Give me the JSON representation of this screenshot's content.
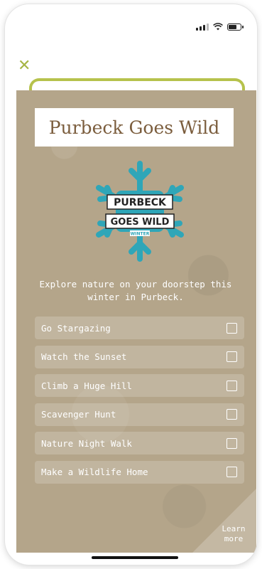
{
  "app": {
    "title": "Purbeck Goes Wild",
    "intro": "Explore nature on your doorstep this winter in Purbeck.",
    "learn_more": "Learn more",
    "close_icon": "close-icon",
    "colors": {
      "card": "#b4a58a",
      "accent": "#b6c24c",
      "title": "#7b5d3d",
      "logo_teal": "#2fa6b8"
    }
  },
  "logo": {
    "line1": "PURBECK",
    "line2": "GOES WILD",
    "badge": "WINTER"
  },
  "tasks": [
    {
      "label": "Go Stargazing",
      "checked": false
    },
    {
      "label": "Watch the Sunset",
      "checked": false
    },
    {
      "label": "Climb a Huge Hill",
      "checked": false
    },
    {
      "label": "Scavenger Hunt",
      "checked": false
    },
    {
      "label": "Nature Night Walk",
      "checked": false
    },
    {
      "label": "Make a Wildlife Home",
      "checked": false
    }
  ]
}
